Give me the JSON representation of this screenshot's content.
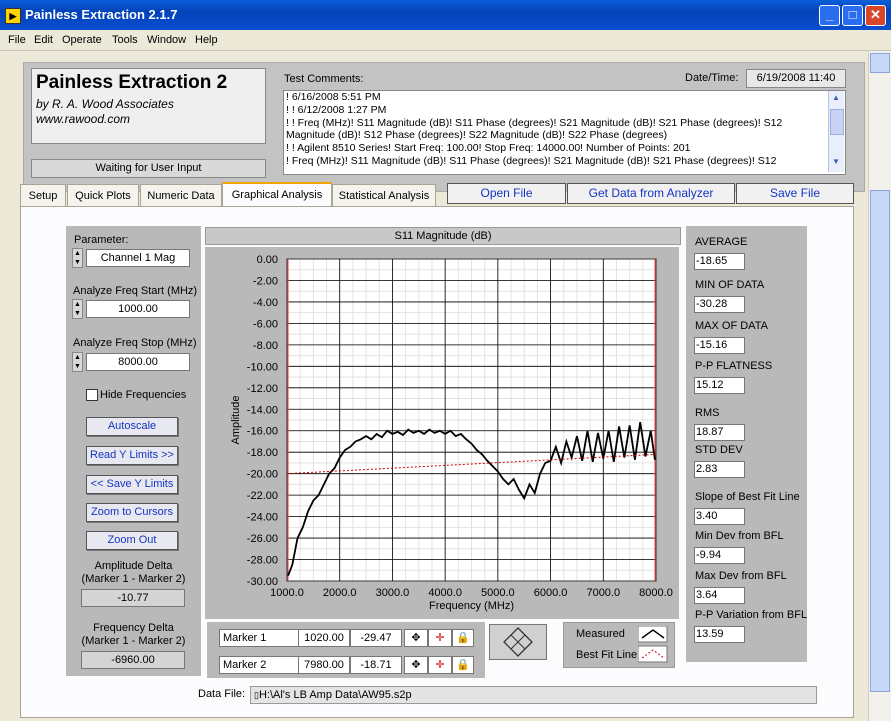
{
  "window": {
    "title": "Painless Extraction 2.1.7",
    "icon": "labview-icon",
    "minimize": "_",
    "maximize": "□",
    "close": "✕"
  },
  "menu": [
    "File",
    "Edit",
    "Operate",
    "Tools",
    "Window",
    "Help"
  ],
  "header": {
    "logo_title": "Painless Extraction 2",
    "logo_by": "by R. A. Wood Associates",
    "logo_web": "www.rawood.com",
    "status": "Waiting for User Input",
    "comments_label": "Test Comments:",
    "comments": [
      "! 6/16/2008 5:51 PM",
      "! ! 6/12/2008 1:27 PM",
      "! ! Freq (MHz)! S11 Magnitude (dB)! S11 Phase (degrees)! S21 Magnitude (dB)! S21 Phase (degrees)! S12",
      "Magnitude (dB)! S12 Phase (degrees)! S22 Magnitude (dB)! S22 Phase (degrees)",
      "! ! Agilent 8510 Series! Start Freq: 100.00! Stop Freq: 14000.00! Number of Points: 201",
      "! Freq (MHz)! S11 Magnitude (dB)! S11 Phase (degrees)! S21 Magnitude (dB)! S21 Phase (degrees)! S12"
    ],
    "date_label": "Date/Time:",
    "date_value": "6/19/2008  11:40"
  },
  "tabs": [
    "Setup",
    "Quick Plots",
    "Numeric Data",
    "Graphical Analysis",
    "Statistical Analysis"
  ],
  "active_tab": "Graphical Analysis",
  "actions": {
    "open": "Open File",
    "get": "Get Data from Analyzer",
    "save": "Save File"
  },
  "left": {
    "parameter_label": "Parameter:",
    "parameter_value": "Channel 1 Mag",
    "start_label": "Analyze Freq Start (MHz)",
    "start_value": "1000.00",
    "stop_label": "Analyze Freq Stop (MHz)",
    "stop_value": "8000.00",
    "hide_freq": "Hide Frequencies",
    "hide_freq_checked": false,
    "btn_autoscale": "Autoscale",
    "btn_read_y": "Read Y Limits >>",
    "btn_save_y": "<< Save Y Limits",
    "btn_zoom_cursors": "Zoom to Cursors",
    "btn_zoom_out": "Zoom Out",
    "amp_delta_label1": "Amplitude Delta",
    "amp_delta_label2": "(Marker 1 - Marker 2)",
    "amp_delta_value": "-10.77",
    "freq_delta_label1": "Frequency Delta",
    "freq_delta_label2": "(Marker 1 - Marker 2)",
    "freq_delta_value": "-6960.00"
  },
  "stats": [
    {
      "label": "AVERAGE",
      "value": "-18.65"
    },
    {
      "label": "MIN OF DATA",
      "value": "-30.28"
    },
    {
      "label": "MAX OF DATA",
      "value": "-15.16"
    },
    {
      "label": "P-P FLATNESS",
      "value": "15.12"
    },
    {
      "label": "RMS",
      "value": "18.87"
    },
    {
      "label": "STD DEV",
      "value": "2.83"
    },
    {
      "label": "Slope of Best Fit Line",
      "value": "3.40"
    },
    {
      "label": "Min Dev from BFL",
      "value": "-9.94"
    },
    {
      "label": "Max Dev from BFL",
      "value": "3.64"
    },
    {
      "label": "P-P Variation from BFL",
      "value": "13.59"
    }
  ],
  "markers": [
    {
      "name": "Marker 1",
      "freq": "1020.00",
      "amp": "-29.47"
    },
    {
      "name": "Marker 2",
      "freq": "7980.00",
      "amp": "-18.71"
    }
  ],
  "legend": {
    "measured": "Measured",
    "bfl": "Best Fit Line",
    "measured_color": "#000000",
    "bfl_color": "#cc0000"
  },
  "datafile": {
    "label": "Data File:",
    "path": "H:\\Al's LB Amp Data\\AW95.s2p"
  },
  "chart_data": {
    "type": "line",
    "title": "S11 Magnitude (dB)",
    "xlabel": "Frequency (MHz)",
    "ylabel": "Amplitude",
    "xlim": [
      1000,
      8000
    ],
    "ylim": [
      -30,
      0
    ],
    "grid": true,
    "x_ticks": [
      "1000.0",
      "2000.0",
      "3000.0",
      "4000.0",
      "5000.0",
      "6000.0",
      "7000.0",
      "8000.0"
    ],
    "y_ticks": [
      "0.00",
      "-2.00",
      "-4.00",
      "-6.00",
      "-8.00",
      "-10.00",
      "-12.00",
      "-14.00",
      "-16.00",
      "-18.00",
      "-20.00",
      "-22.00",
      "-24.00",
      "-26.00",
      "-28.00",
      "-30.00"
    ],
    "series": [
      {
        "name": "Measured",
        "color": "#000000",
        "x": [
          1020,
          1100,
          1200,
          1300,
          1400,
          1500,
          1600,
          1700,
          1800,
          1900,
          2000,
          2100,
          2200,
          2300,
          2400,
          2500,
          2600,
          2700,
          2800,
          2900,
          3000,
          3100,
          3200,
          3300,
          3400,
          3500,
          3600,
          3700,
          3800,
          3900,
          4000,
          4100,
          4200,
          4300,
          4400,
          4500,
          4600,
          4700,
          4800,
          4900,
          5000,
          5100,
          5200,
          5300,
          5400,
          5500,
          5600,
          5700,
          5800,
          5900,
          6000,
          6100,
          6200,
          6300,
          6400,
          6500,
          6600,
          6700,
          6800,
          6900,
          7000,
          7100,
          7200,
          7300,
          7400,
          7500,
          7600,
          7700,
          7800,
          7900,
          7980
        ],
        "y": [
          -29.5,
          -28.5,
          -26.0,
          -25.0,
          -23.5,
          -22.5,
          -22.0,
          -21.0,
          -20.0,
          -19.5,
          -18.5,
          -17.8,
          -17.5,
          -17.0,
          -16.8,
          -16.5,
          -16.8,
          -16.3,
          -16.6,
          -16.0,
          -16.3,
          -16.1,
          -16.4,
          -15.9,
          -16.2,
          -16.0,
          -16.3,
          -15.9,
          -16.2,
          -16.0,
          -16.3,
          -16.0,
          -16.5,
          -16.3,
          -16.8,
          -17.2,
          -17.8,
          -18.2,
          -18.8,
          -19.3,
          -19.8,
          -20.5,
          -21.0,
          -20.5,
          -21.5,
          -22.3,
          -21.0,
          -21.8,
          -20.0,
          -19.0,
          -18.8,
          -17.5,
          -19.0,
          -17.0,
          -18.5,
          -16.5,
          -18.8,
          -16.0,
          -18.9,
          -16.2,
          -18.6,
          -16.0,
          -18.9,
          -15.6,
          -18.5,
          -15.5,
          -18.7,
          -15.2,
          -18.4,
          -16.0,
          -18.7
        ]
      },
      {
        "name": "Best Fit Line",
        "color": "#cc0000",
        "x": [
          1000,
          8000
        ],
        "y": [
          -20.0,
          -18.2
        ]
      }
    ],
    "markers_x": [
      1020,
      7980
    ]
  }
}
